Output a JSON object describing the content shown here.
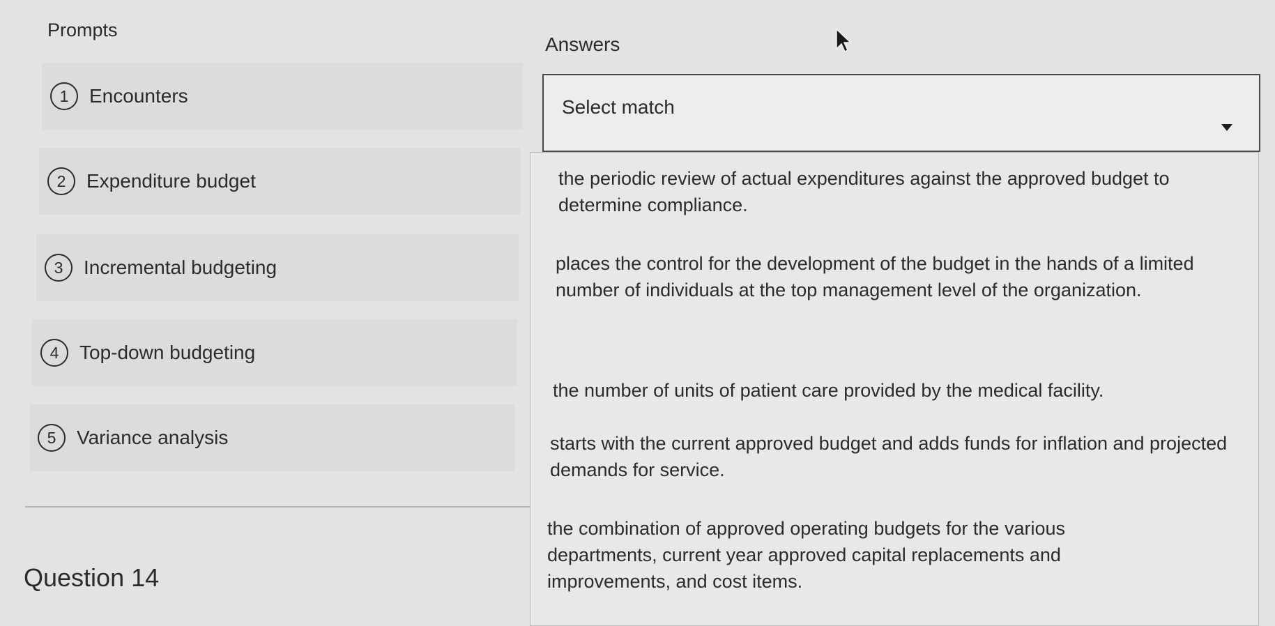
{
  "prompts": {
    "title": "Prompts",
    "items": [
      {
        "num": "1",
        "label": "Encounters"
      },
      {
        "num": "2",
        "label": "Expenditure budget"
      },
      {
        "num": "3",
        "label": "Incremental budgeting"
      },
      {
        "num": "4",
        "label": "Top-down budgeting"
      },
      {
        "num": "5",
        "label": "Variance analysis"
      }
    ]
  },
  "answers": {
    "title": "Answers",
    "select_value": "Select match",
    "options": [
      "the periodic review of actual expenditures against the approved budget to determine compliance.",
      "places the control for the development of the budget in the hands of a limited number of individuals at the top management level of the organization.",
      "the number of units of patient care provided by the medical facility.",
      "starts with the current approved budget and adds funds for inflation and projected demands for service.",
      "the combination of approved operating budgets for the various departments, current year approved capital replacements and improvements, and cost items."
    ]
  },
  "question": {
    "label": "Question 14"
  },
  "icons": {
    "dropdown": "caret-down-icon",
    "pointer": "mouse-pointer-icon"
  }
}
